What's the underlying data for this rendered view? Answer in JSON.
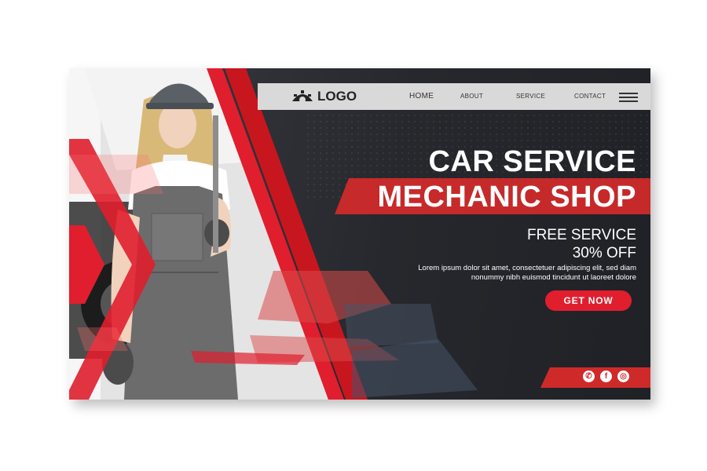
{
  "brand": {
    "logo_text": "LOGO",
    "accent": "#e01e2e",
    "dark": "#26282d"
  },
  "nav": {
    "items": [
      {
        "label": "HOME"
      },
      {
        "label": "ABOUT"
      },
      {
        "label": "SERVICE"
      },
      {
        "label": "CONTACT"
      }
    ]
  },
  "hero": {
    "title_line1": "CAR SERVICE",
    "title_line2": "MECHANIC SHOP",
    "offer_line1": "FREE SERVICE",
    "offer_line2": "30% OFF",
    "description": "Lorem ipsum dolor sit amet, consectetuer adipiscing elit, sed diam nonummy nibh euismod tincidunt ut laoreet dolore",
    "cta_label": "GET NOW"
  },
  "social": {
    "icons": [
      "whatsapp-icon",
      "facebook-icon",
      "instagram-icon"
    ],
    "glyphs": [
      "✆",
      "f",
      "◎"
    ]
  }
}
